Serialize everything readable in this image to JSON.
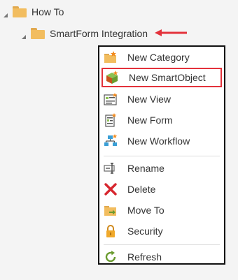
{
  "tree": {
    "root": {
      "label": "How To"
    },
    "child": {
      "label": "SmartForm Integration"
    }
  },
  "context_menu": {
    "items": [
      {
        "label": "New Category",
        "icon": "new-category-icon"
      },
      {
        "label": "New SmartObject",
        "icon": "new-smartobject-icon",
        "highlighted": true
      },
      {
        "label": "New View",
        "icon": "new-view-icon"
      },
      {
        "label": "New Form",
        "icon": "new-form-icon"
      },
      {
        "label": "New Workflow",
        "icon": "new-workflow-icon"
      },
      {
        "label": "Rename",
        "icon": "rename-icon"
      },
      {
        "label": "Delete",
        "icon": "delete-icon"
      },
      {
        "label": "Move To",
        "icon": "move-to-icon"
      },
      {
        "label": "Security",
        "icon": "lock-icon"
      },
      {
        "label": "Refresh",
        "icon": "refresh-icon"
      }
    ]
  },
  "colors": {
    "highlight_border": "#e3323b",
    "arrow": "#e3323b",
    "folder": "#f2bd5f"
  }
}
